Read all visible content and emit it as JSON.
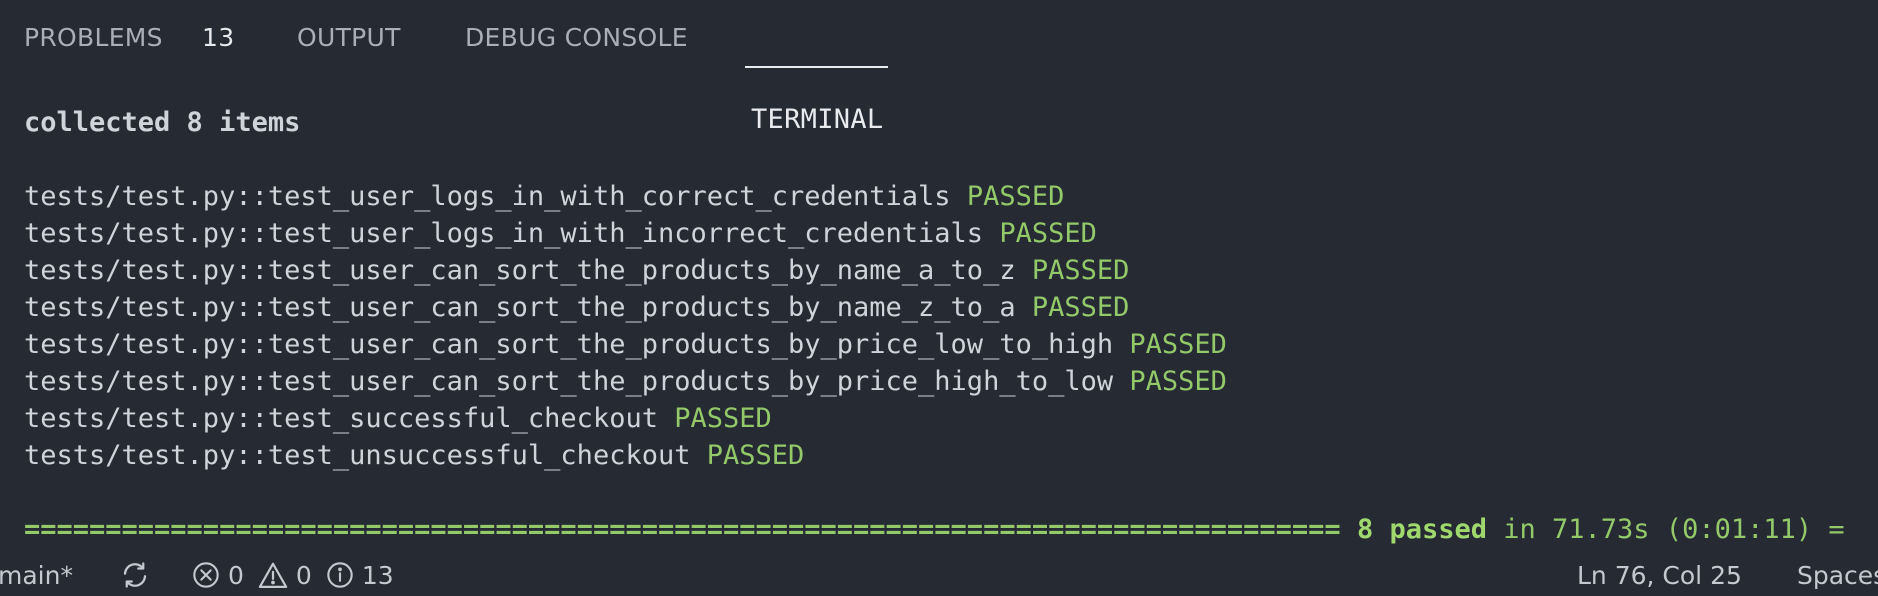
{
  "panel": {
    "tabs": [
      {
        "label": "PROBLEMS",
        "count": "13",
        "active": false
      },
      {
        "label": "OUTPUT",
        "active": false
      },
      {
        "label": "DEBUG CONSOLE",
        "active": false
      },
      {
        "label": "TERMINAL",
        "active": true
      }
    ]
  },
  "terminal": {
    "header": "collected 8 items",
    "tests": [
      {
        "name": "tests/test.py::test_user_logs_in_with_correct_credentials",
        "status": "PASSED"
      },
      {
        "name": "tests/test.py::test_user_logs_in_with_incorrect_credentials",
        "status": "PASSED"
      },
      {
        "name": "tests/test.py::test_user_can_sort_the_products_by_name_a_to_z",
        "status": "PASSED"
      },
      {
        "name": "tests/test.py::test_user_can_sort_the_products_by_name_z_to_a",
        "status": "PASSED"
      },
      {
        "name": "tests/test.py::test_user_can_sort_the_products_by_price_low_to_high",
        "status": "PASSED"
      },
      {
        "name": "tests/test.py::test_user_can_sort_the_products_by_price_high_to_low",
        "status": "PASSED"
      },
      {
        "name": "tests/test.py::test_successful_checkout",
        "status": "PASSED"
      },
      {
        "name": "tests/test.py::test_unsuccessful_checkout",
        "status": "PASSED"
      }
    ],
    "summary": {
      "separator": "=================================================================================",
      "passed": "8 passed",
      "time": " in 71.73s (0:01:11) ="
    }
  },
  "statusbar": {
    "branch": "main*",
    "errors": "0",
    "warnings": "0",
    "infos": "13",
    "cursor": "Ln 76, Col 25",
    "spaces": "Spaces"
  },
  "colors": {
    "background": "#262a33",
    "passed": "#94c96a",
    "active_tab": "#e9ebee",
    "inactive_tab": "#a9aeb8"
  },
  "icons": {
    "sync": "sync-icon",
    "error": "error-circle-icon",
    "warning": "warning-triangle-icon",
    "info": "info-circle-icon"
  }
}
